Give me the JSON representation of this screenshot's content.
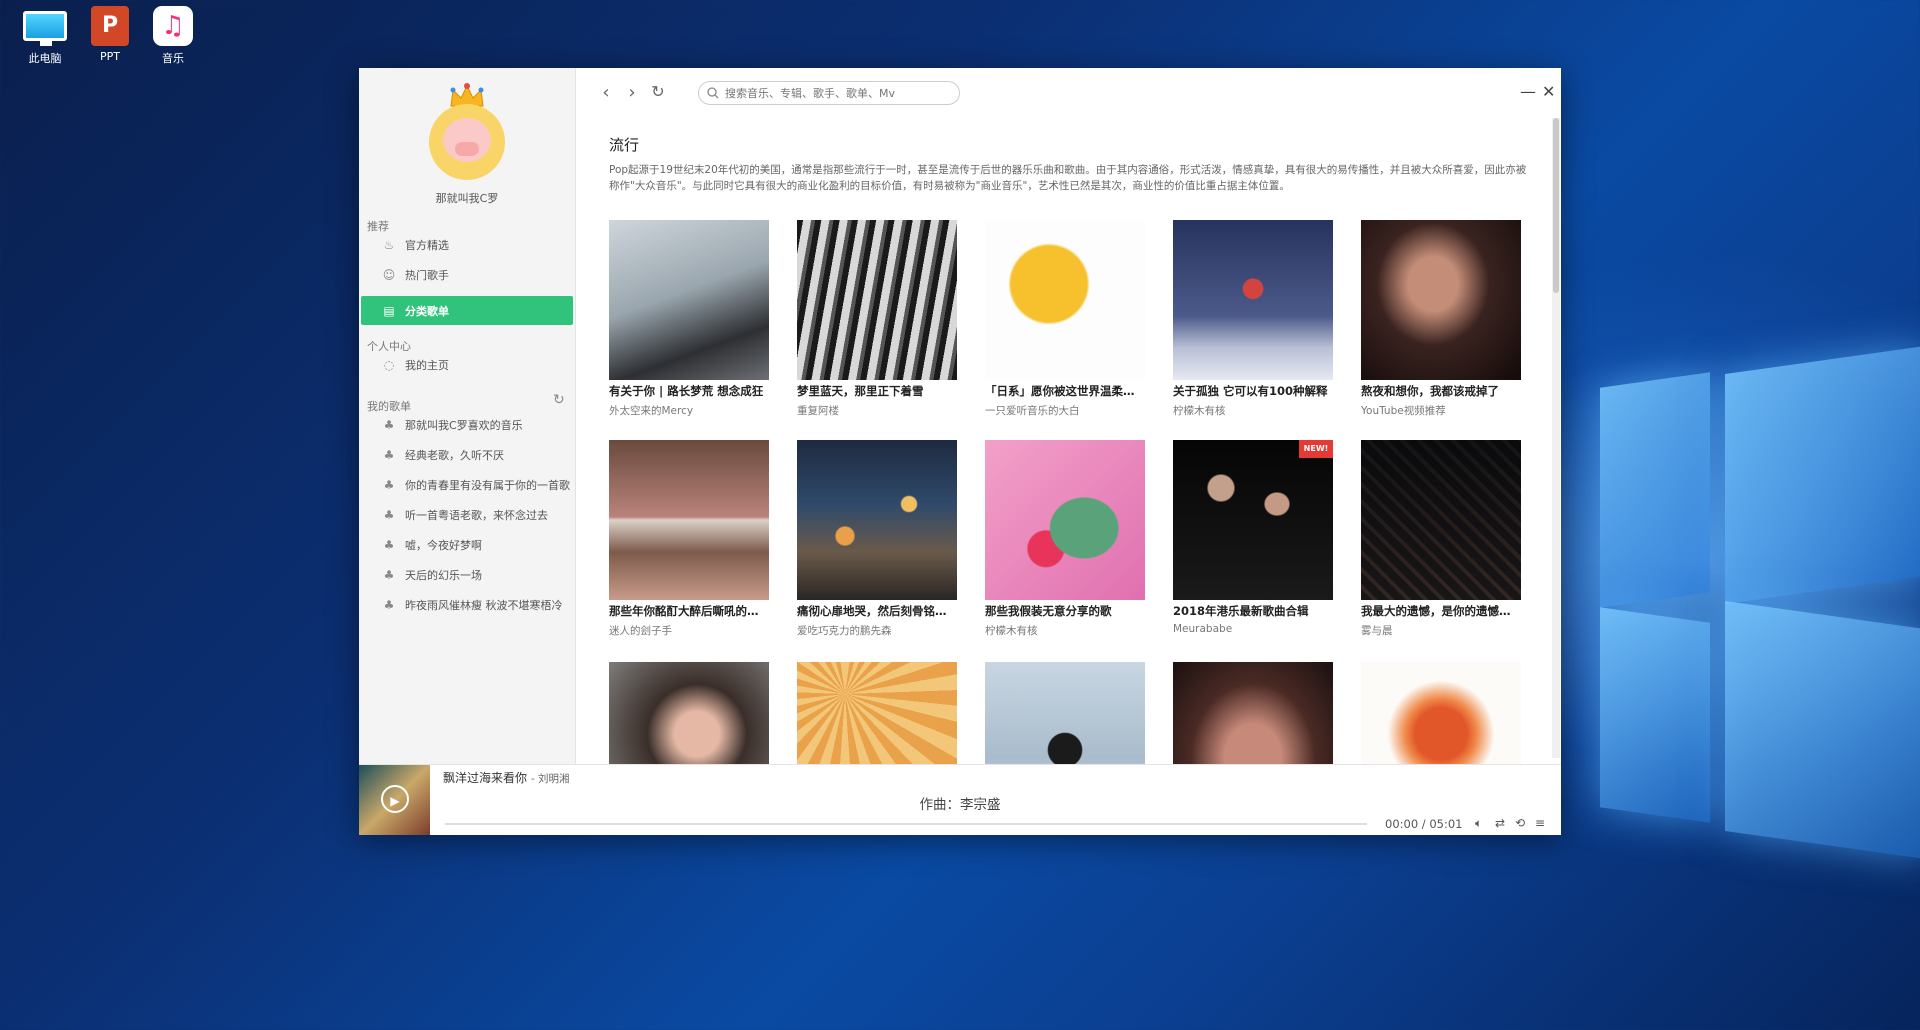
{
  "desktop": {
    "icons": [
      {
        "label": "此电脑"
      },
      {
        "label": "PPT"
      },
      {
        "label": "音乐"
      }
    ]
  },
  "sidebar": {
    "username": "那就叫我C罗",
    "section_recommend": "推荐",
    "recommend_items": [
      "官方精选",
      "热门歌手",
      "分类歌单"
    ],
    "section_personal": "个人中心",
    "personal_items": [
      "我的主页"
    ],
    "section_playlists": "我的歌单",
    "playlists": [
      "那就叫我C罗喜欢的音乐",
      "经典老歌，久听不厌",
      "你的青春里有没有属于你的一首歌",
      "听一首粤语老歌，来怀念过去",
      "嘘，今夜好梦啊",
      "天后的幻乐一场",
      "昨夜雨风催林瘦 秋波不堪寒梧冷"
    ]
  },
  "toolbar": {
    "search_placeholder": "搜索音乐、专辑、歌手、歌单、Mv"
  },
  "category": {
    "title": "流行",
    "description": "Pop起源于19世纪末20年代初的美国，通常是指那些流行于一时，甚至是流传于后世的器乐乐曲和歌曲。由于其内容通俗，形式活泼，情感真挚，具有很大的易传播性，并且被大众所喜爱，因此亦被称作\"大众音乐\"。与此同时它具有很大的商业化盈利的目标价值，有时易被称为\"商业音乐\"，艺术性已然是其次，商业性的价值比重占据主体位置。"
  },
  "playlists_grid": [
    {
      "title": "有关于你 | 路长梦荒 想念成狂",
      "author": "外太空来的Mercy"
    },
    {
      "title": "梦里蓝天，那里正下着雪",
      "author": "重复阿楼"
    },
    {
      "title": "「日系」愿你被这世界温柔以待",
      "author": "一只爱听音乐的大白"
    },
    {
      "title": "关于孤独 它可以有100种解释",
      "author": "柠檬木有核"
    },
    {
      "title": "熬夜和想你，我都该戒掉了",
      "author": "YouTube视频推荐"
    },
    {
      "title": "那些年你酩酊大醉后嘶吼的粤语歌",
      "author": "迷人的刽子手"
    },
    {
      "title": "痛彻心扉地哭，然后刻骨铭心地爱",
      "author": "爱吃巧克力的鹏先森"
    },
    {
      "title": "那些我假装无意分享的歌",
      "author": "柠檬木有核"
    },
    {
      "title": "2018年港乐最新歌曲合辑",
      "author": "Meurababe",
      "badge": "NEW!"
    },
    {
      "title": "我最大的遗憾，是你的遗憾与我有关",
      "author": "雾与晨"
    },
    {
      "title": "",
      "author": ""
    },
    {
      "title": "",
      "author": ""
    },
    {
      "title": "",
      "author": ""
    },
    {
      "title": "",
      "author": ""
    },
    {
      "title": "",
      "author": ""
    }
  ],
  "player": {
    "song": "飘洋过海来看你",
    "artist": "- 刘明湘",
    "lyric": "作曲：李宗盛",
    "time": "00:00 / 05:01",
    "progress": 0
  }
}
